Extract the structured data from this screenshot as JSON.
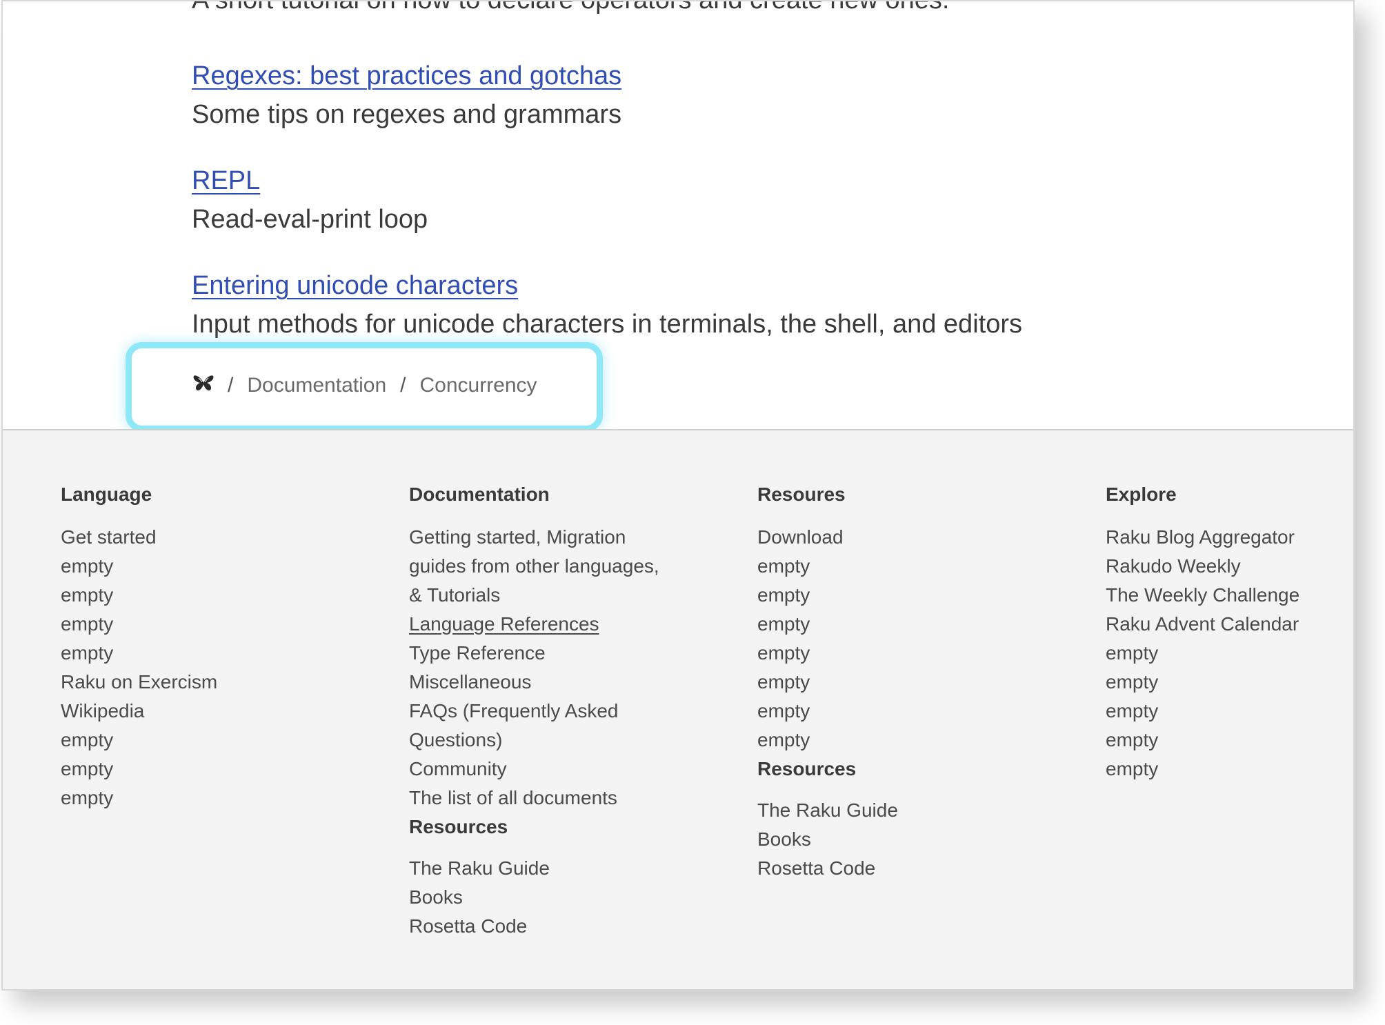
{
  "intro": {
    "text": "A short tutorial on how to declare operators and create new ones."
  },
  "entries": [
    {
      "title": "Regexes: best practices and gotchas",
      "desc": "Some tips on regexes and grammars"
    },
    {
      "title": "REPL",
      "desc": "Read-eval-print loop"
    },
    {
      "title": "Entering unicode characters",
      "desc": "Input methods for unicode characters in terminals, the shell, and editors"
    }
  ],
  "breadcrumb": {
    "home_icon": "butterfly-icon",
    "separator": "/",
    "items": [
      "Documentation",
      "Concurrency"
    ]
  },
  "footer": {
    "columns": [
      {
        "heading": "Language",
        "items": [
          "Get started",
          "empty",
          "empty",
          "empty",
          "empty",
          "Raku on Exercism",
          "Wikipedia",
          "empty",
          "empty",
          "empty"
        ]
      },
      {
        "heading": "Documentation",
        "items": [
          "Getting started, Migration",
          "guides from other languages,",
          "& Tutorials",
          "Language References",
          "Type Reference",
          "Miscellaneous",
          "FAQs (Frequently Asked",
          "Questions)",
          "Community",
          "The list of all documents"
        ],
        "sub_heading": "Resources",
        "sub_items": [
          "The Raku Guide",
          "Books",
          "Rosetta Code"
        ]
      },
      {
        "heading": "Resoures",
        "items": [
          "Download",
          "empty",
          "empty",
          "empty",
          "empty",
          "empty",
          "empty",
          "empty"
        ],
        "sub_heading": "Resources",
        "sub_items": [
          "The Raku Guide",
          "Books",
          "Rosetta Code"
        ]
      },
      {
        "heading": "Explore",
        "items": [
          "Raku Blog Aggregator",
          "Rakudo Weekly",
          "The Weekly Challenge",
          "Raku Advent Calendar",
          "empty",
          "empty",
          "empty",
          "empty",
          "empty"
        ]
      }
    ]
  },
  "colors": {
    "link": "#2f4db3",
    "text": "#3a3a3a",
    "footer_bg": "#f3f3f3",
    "highlight": "#8ee8f6"
  }
}
